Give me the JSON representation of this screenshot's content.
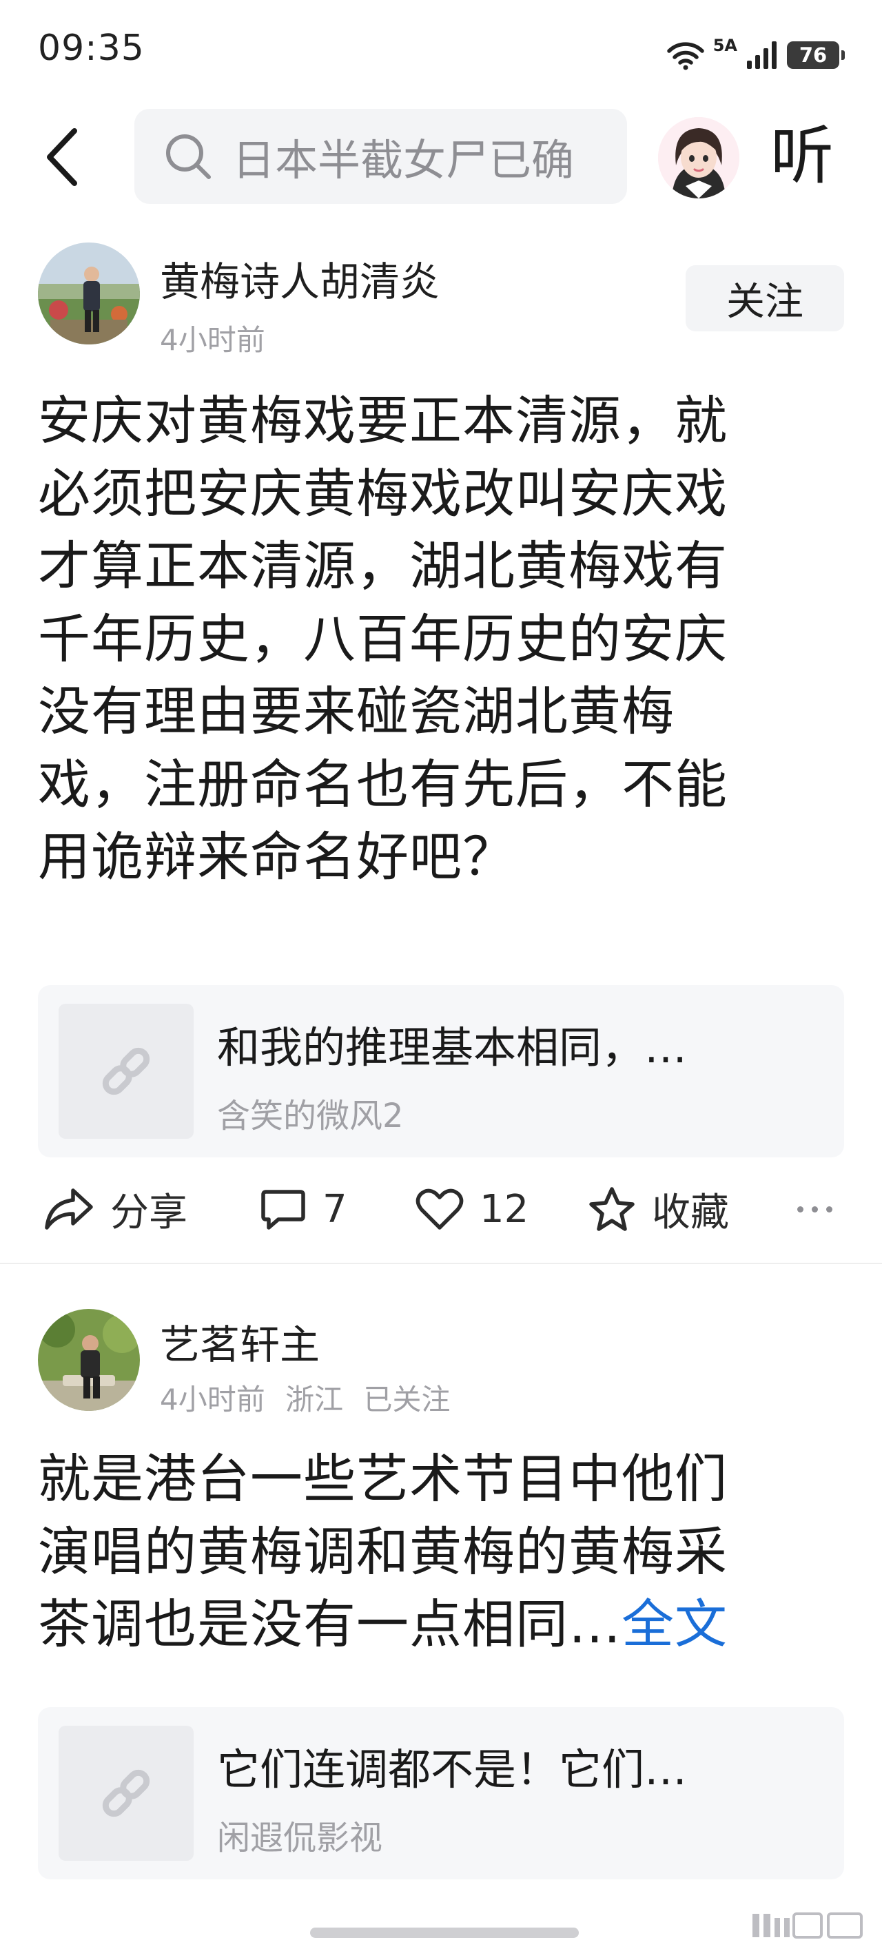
{
  "status_bar": {
    "time": "09:35",
    "network": "5A",
    "battery": "76"
  },
  "header": {
    "search_placeholder": "日本半截女尸已确",
    "listen_label": "听"
  },
  "posts": [
    {
      "author": "黄梅诗人胡清炎",
      "time": "4小时前",
      "follow_label": "关注",
      "lines": [
        "安庆对黄梅戏要正本清源，就",
        "必须把安庆黄梅戏改叫安庆戏",
        "才算正本清源，湖北黄梅戏有",
        "千年历史，八百年历史的安庆",
        "没有理由要来碰瓷湖北黄梅",
        "戏，注册命名也有先后，不能",
        "用诡辩来命名好吧？"
      ],
      "quote": {
        "title": "和我的推理基本相同，…",
        "source": "含笑的微风2"
      },
      "actions": {
        "share": "分享",
        "comments": "7",
        "likes": "12",
        "favorite": "收藏"
      }
    },
    {
      "author": "艺茗轩主",
      "time": "4小时前",
      "location": "浙江",
      "follow_status": "已关注",
      "lines": [
        "就是港台一些艺术节目中他们",
        "演唱的黄梅调和黄梅的黄梅采",
        "茶调也是没有一点相同…"
      ],
      "full_text_label": "全文",
      "quote": {
        "title": "它们连调都不是！它们…",
        "source": "闲遐侃影视"
      }
    }
  ]
}
